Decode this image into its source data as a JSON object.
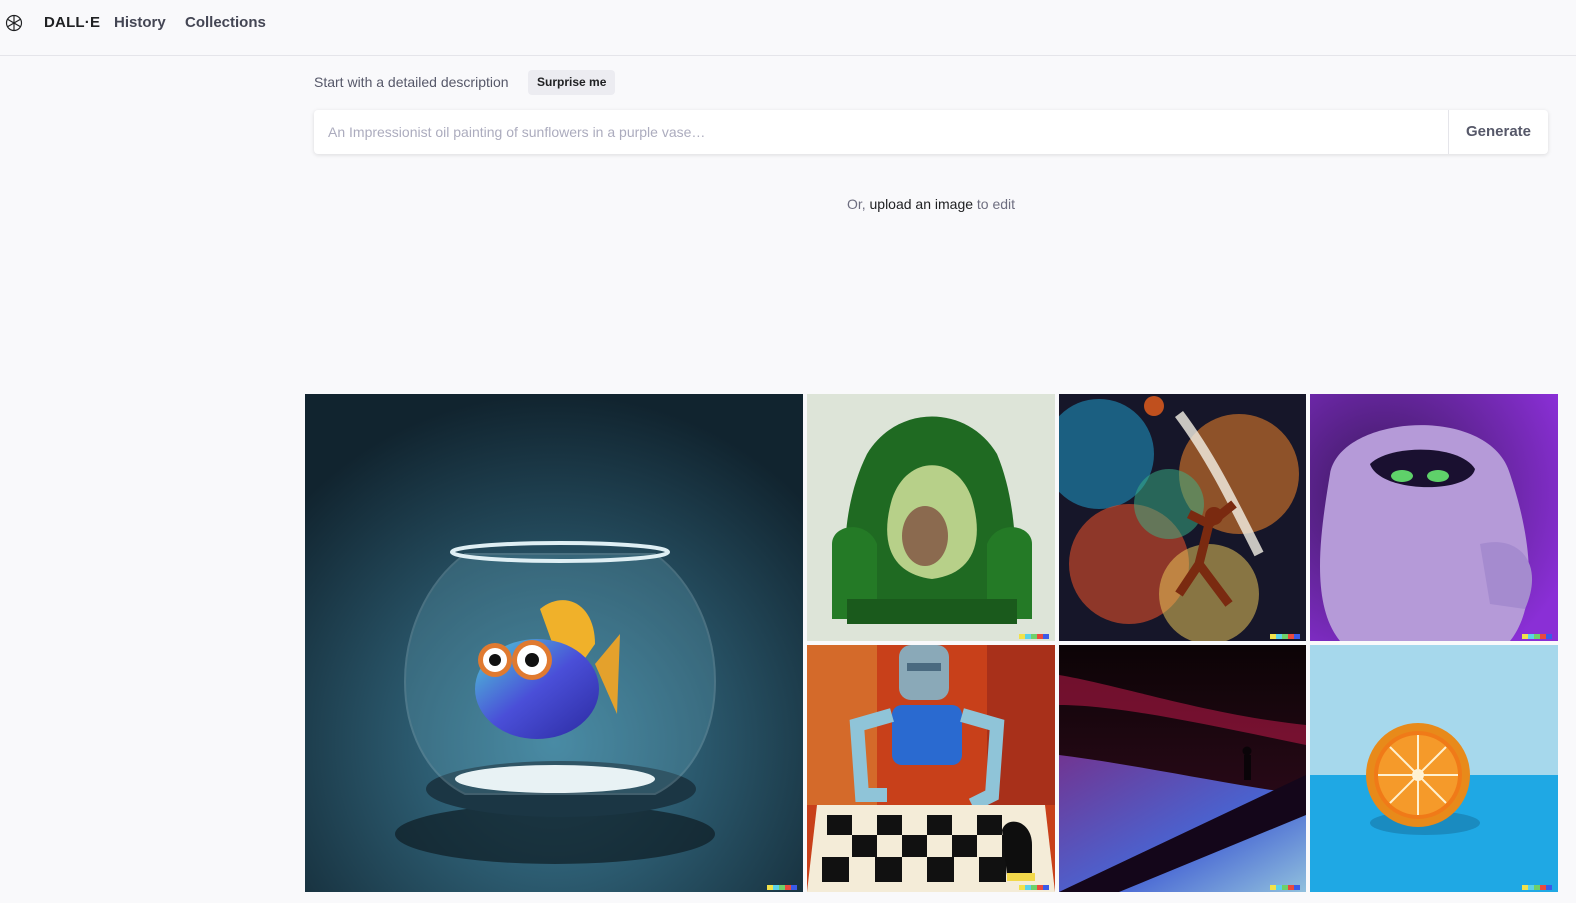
{
  "header": {
    "logo_icon": "openai-logo-icon",
    "brand": "DALL·E",
    "nav": [
      {
        "label": "History"
      },
      {
        "label": "Collections"
      }
    ]
  },
  "prompt": {
    "label": "Start with a detailed description",
    "surprise_label": "Surprise me",
    "placeholder": "An Impressionist oil painting of sunflowers in a purple vase…",
    "value": "",
    "generate_label": "Generate"
  },
  "upload": {
    "prefix": "Or, ",
    "link": "upload an image",
    "suffix": " to edit"
  },
  "gallery": {
    "tiles": [
      {
        "subject": "fish-in-fishbowl-image",
        "bg": "#1d3a4a"
      },
      {
        "subject": "avocado-armchair-image",
        "bg": "#dfe6d9"
      },
      {
        "subject": "cosmic-basketball-player-image",
        "bg": "#1a1a2a"
      },
      {
        "subject": "purple-furry-monster-image",
        "bg": "#6a2fb5"
      },
      {
        "subject": "robot-playing-chess-image",
        "bg": "#c8401a"
      },
      {
        "subject": "figure-on-dune-image",
        "bg": "#2a0a18"
      },
      {
        "subject": "orange-half-image",
        "bg": "#36a8d8"
      }
    ]
  }
}
